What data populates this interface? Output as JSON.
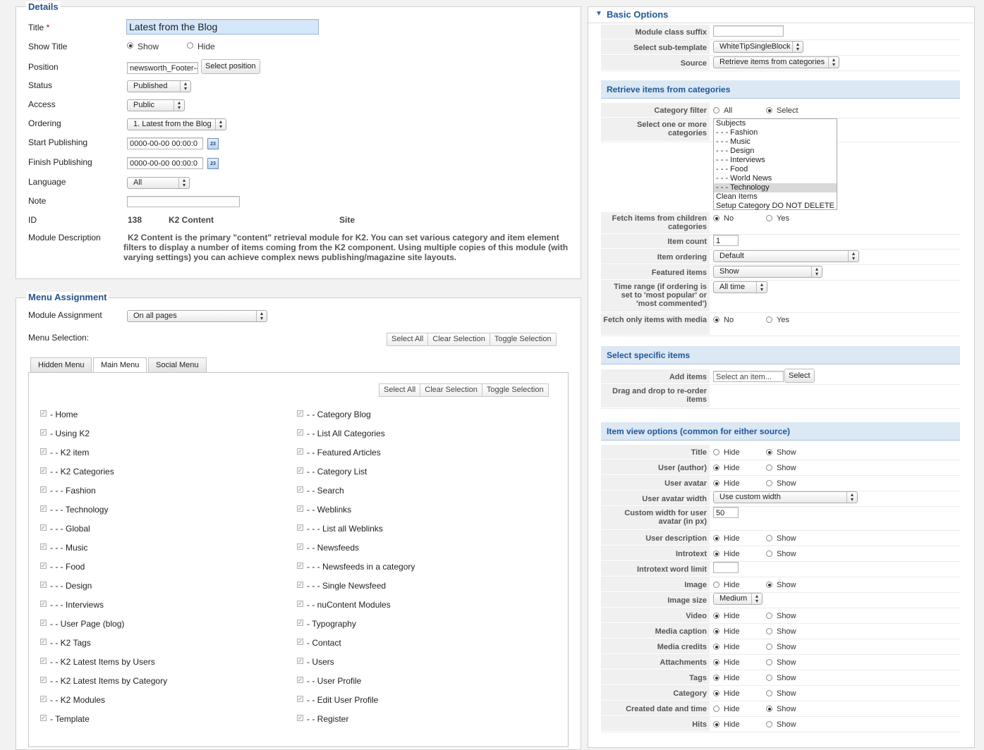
{
  "details": {
    "legend": "Details",
    "title_label": "Title",
    "required_mark": "*",
    "title_value": "Latest from the Blog",
    "show_title_label": "Show Title",
    "show_title_show": "Show",
    "show_title_hide": "Hide",
    "position_label": "Position",
    "position_value": "newsworth_Footer--",
    "select_position_label": "Select position",
    "status_label": "Status",
    "status_value": "Published",
    "access_label": "Access",
    "access_value": "Public",
    "ordering_label": "Ordering",
    "ordering_value": "1. Latest from the Blog",
    "start_publishing_label": "Start Publishing",
    "start_publishing_value": "0000-00-00 00:00:0",
    "finish_publishing_label": "Finish Publishing",
    "finish_publishing_value": "0000-00-00 00:00:0",
    "language_label": "Language",
    "language_value": "All",
    "note_label": "Note",
    "note_value": "",
    "id_label": "ID",
    "id_value": "138",
    "module_type": "K2 Content",
    "client": "Site",
    "module_description_label": "Module Description",
    "module_description": "K2 Content is the primary \"content\" retrieval module for K2. You can set various category and item element filters to display a number of items coming from the K2 component. Using multiple copies of this module (with varying settings) you can achieve complex news publishing/magazine site layouts.",
    "calendar_icon_text": "23"
  },
  "menu_assignment": {
    "legend": "Menu Assignment",
    "module_assignment_label": "Module Assignment",
    "module_assignment_value": "On all pages",
    "menu_selection_label": "Menu Selection:",
    "select_all": "Select All",
    "clear_selection": "Clear Selection",
    "toggle_selection": "Toggle Selection",
    "tabs": [
      "Hidden Menu",
      "Main Menu",
      "Social Menu"
    ],
    "left_items": [
      "- Home",
      "- Using K2",
      "- - K2 item",
      "- - K2 Categories",
      "- - - Fashion",
      "- - - Technology",
      "- - - Global",
      "- - - Music",
      "- - - Food",
      "- - - Design",
      "- - - Interviews",
      "- - User Page (blog)",
      "- - K2 Tags",
      "- - K2 Latest Items by Users",
      "- - K2 Latest Items by Category",
      "- - K2 Modules",
      "- Template"
    ],
    "right_items": [
      "- - Category Blog",
      "- - List All Categories",
      "- - Featured Articles",
      "- - Category List",
      "- - Search",
      "- - Weblinks",
      "- - - List all Weblinks",
      "- - Newsfeeds",
      "- - - Newsfeeds in a category",
      "- - - Single Newsfeed",
      "- - nuContent Modules",
      "- Typography",
      "- Contact",
      "- Users",
      "- - User Profile",
      "- - Edit User Profile",
      "- - Register"
    ]
  },
  "basic_options": {
    "header": "Basic Options",
    "module_class_suffix_label": "Module class suffix",
    "module_class_suffix_value": "",
    "sub_template_label": "Select sub-template",
    "sub_template_value": "WhiteTipSingleBlock",
    "source_label": "Source",
    "source_value": "Retrieve items from categories",
    "sec_categories": "Retrieve items from categories",
    "category_filter_label": "Category filter",
    "opt_all": "All",
    "opt_select": "Select",
    "select_categories_label": "Select one or more categories",
    "categories": [
      "Subjects",
      "- - - Fashion",
      "- - - Music",
      "- - - Design",
      "- - - Interviews",
      "- - - Food",
      "- - - World News",
      "- - - Technology",
      "Clean Items",
      "Setup Category DO NOT DELETE"
    ],
    "selected_category": "- - - Technology",
    "fetch_children_label": "Fetch items from children categories",
    "opt_no": "No",
    "opt_yes": "Yes",
    "item_count_label": "Item count",
    "item_count_value": "1",
    "item_ordering_label": "Item ordering",
    "item_ordering_value": "Default",
    "featured_items_label": "Featured items",
    "featured_items_value": "Show",
    "time_range_label": "Time range (if ordering is set to 'most popular' or 'most commented')",
    "time_range_value": "All time",
    "fetch_media_label": "Fetch only items with media",
    "sec_specific": "Select specific items",
    "add_items_label": "Add items",
    "add_items_placeholder": "Select an item...",
    "select_button": "Select",
    "drag_drop_label": "Drag and drop to re-order items",
    "sec_item_view": "Item view options (common for either source)",
    "opt_hide": "Hide",
    "opt_show": "Show",
    "title_label": "Title",
    "user_author_label": "User (author)",
    "user_avatar_label": "User avatar",
    "user_avatar_width_label": "User avatar width",
    "user_avatar_width_value": "Use custom width",
    "custom_width_label": "Custom width for user avatar (in px)",
    "custom_width_value": "50",
    "user_description_label": "User description",
    "introtext_label": "Introtext",
    "introtext_limit_label": "Introtext word limit",
    "introtext_limit_value": "",
    "image_label": "Image",
    "image_size_label": "Image size",
    "image_size_value": "Medium",
    "video_label": "Video",
    "media_caption_label": "Media caption",
    "media_credits_label": "Media credits",
    "attachments_label": "Attachments",
    "tags_label": "Tags",
    "category_label": "Category",
    "created_date_label": "Created date and time",
    "hits_label": "Hits"
  }
}
